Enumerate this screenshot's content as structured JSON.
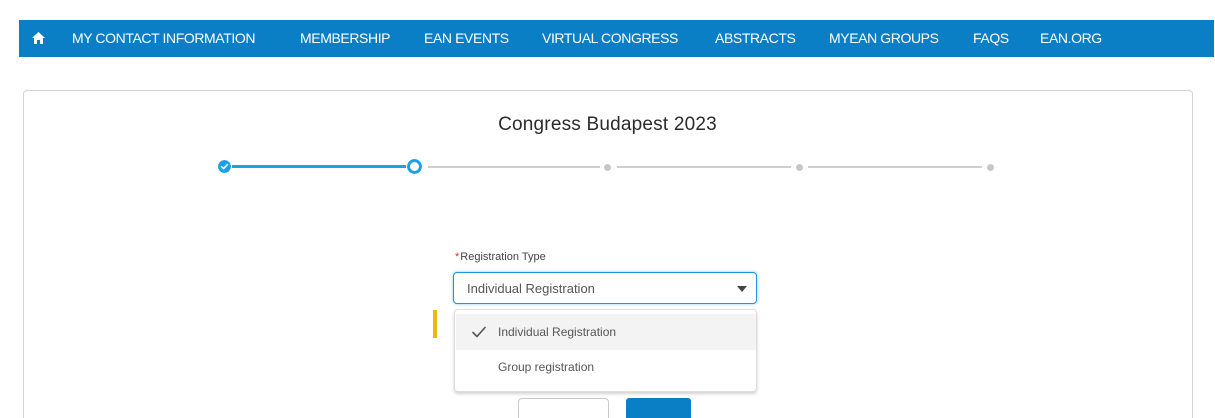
{
  "nav": {
    "home_icon": "home-icon",
    "items": [
      {
        "label": "MY CONTACT INFORMATION"
      },
      {
        "label": "MEMBERSHIP"
      },
      {
        "label": "EAN EVENTS"
      },
      {
        "label": "VIRTUAL CONGRESS"
      },
      {
        "label": "ABSTRACTS"
      },
      {
        "label": "MYEAN GROUPS"
      },
      {
        "label": "FAQS"
      },
      {
        "label": "EAN.ORG"
      }
    ],
    "color": "#0b7fc6"
  },
  "page": {
    "title": "Congress Budapest 2023"
  },
  "progress": {
    "total_steps": 5,
    "current_step": 2,
    "completed_steps": 1,
    "active_color": "#1da1e6",
    "inactive_color": "#cfcfcf"
  },
  "form": {
    "registration_type": {
      "required_marker": "*",
      "label": "Registration Type",
      "value": "Individual Registration",
      "options": [
        {
          "label": "Individual Registration",
          "selected": true
        },
        {
          "label": "Group registration",
          "selected": false
        }
      ]
    }
  },
  "colors": {
    "accent": "#1b96e0",
    "marker": "#f5b40f",
    "required": "#c23934"
  }
}
